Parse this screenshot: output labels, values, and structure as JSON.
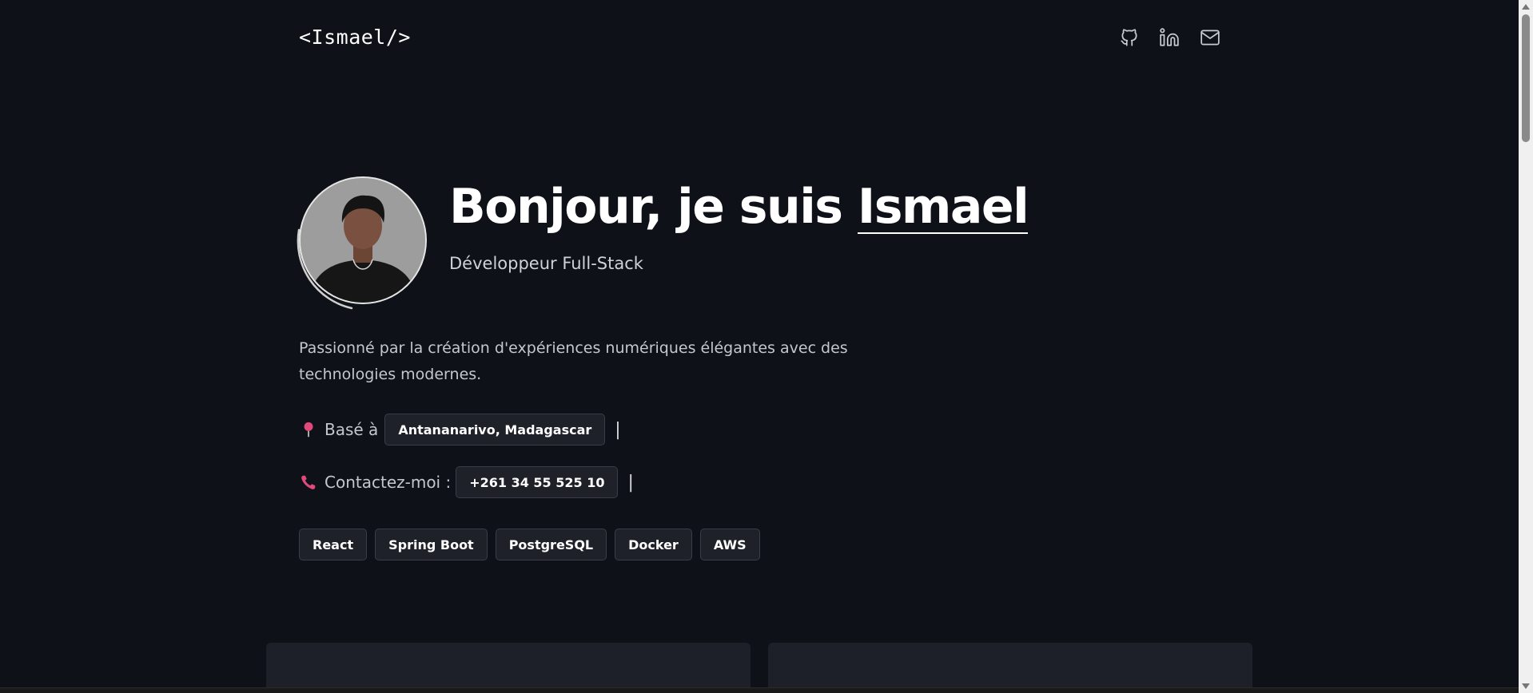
{
  "header": {
    "logo": "<Ismael/>",
    "social": [
      {
        "icon": "github-icon"
      },
      {
        "icon": "linkedin-icon"
      },
      {
        "icon": "mail-icon"
      }
    ]
  },
  "hero": {
    "greeting": "Bonjour, je suis ",
    "name": "Ismael",
    "subtitle": "Développeur Full-Stack",
    "description": "Passionné par la création d'expériences numériques élégantes avec des technologies modernes."
  },
  "location": {
    "label": "Basé à",
    "value": "Antananarivo, Madagascar",
    "caret": "|"
  },
  "contact": {
    "label": "Contactez-moi :",
    "value": "+261 34 55 525 10",
    "caret": "|"
  },
  "skills": [
    "React",
    "Spring Boot",
    "PostgreSQL",
    "Docker",
    "AWS"
  ],
  "colors": {
    "background": "#0f1118",
    "chip_bg": "#1f2129",
    "chip_border": "#3a3d47",
    "pin": "#e04a7a"
  }
}
